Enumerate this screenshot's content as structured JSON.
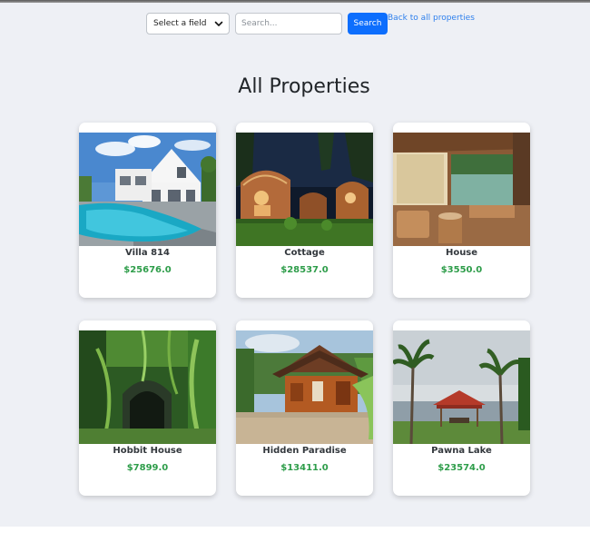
{
  "search": {
    "field_select_label": "Select a field",
    "input_placeholder": "Search...",
    "button_label": "Search",
    "back_link": "Back to all properties"
  },
  "title": "All Properties",
  "properties": [
    {
      "name": "Villa 814",
      "price": "$25676.0",
      "photo": "villa-with-pool-photo"
    },
    {
      "name": "Cottage",
      "price": "$28537.0",
      "photo": "cottage-at-night-photo"
    },
    {
      "name": "House",
      "price": "$3550.0",
      "photo": "wooden-veranda-lake-photo"
    },
    {
      "name": "Hobbit House",
      "price": "$7899.0",
      "photo": "green-garden-tunnel-photo"
    },
    {
      "name": "Hidden Paradise",
      "price": "$13411.0",
      "photo": "tiled-roof-hut-photo"
    },
    {
      "name": "Pawna Lake",
      "price": "$23574.0",
      "photo": "lakeside-gazebo-photo"
    }
  ],
  "colors": {
    "accent": "#0d6efd",
    "price": "#2e9d4a",
    "background": "#eef0f5"
  }
}
